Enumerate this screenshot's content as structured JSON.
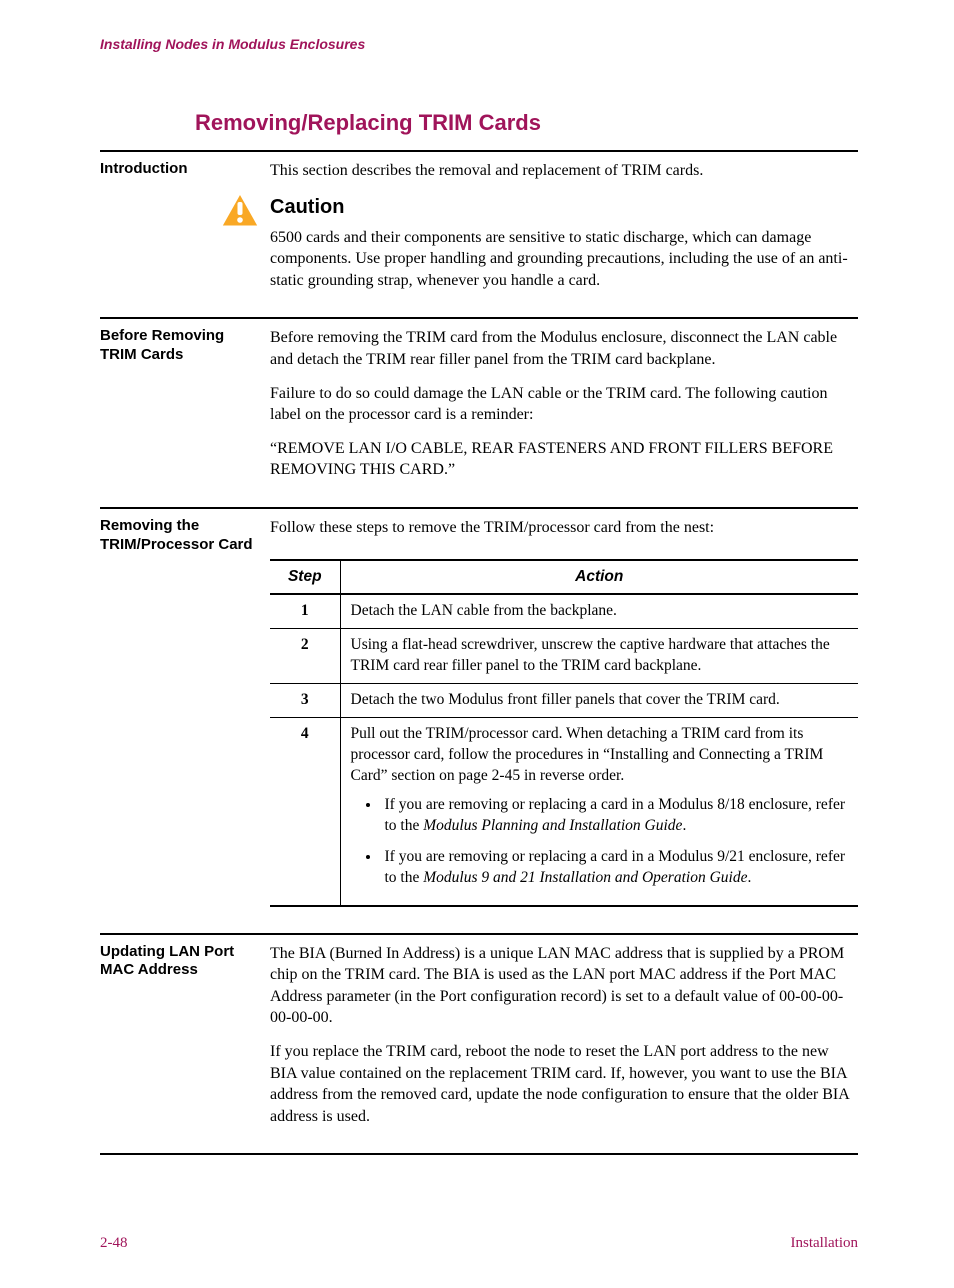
{
  "header": "Installing Nodes in Modulus Enclosures",
  "title": "Removing/Replacing TRIM Cards",
  "intro": {
    "label": "Introduction",
    "text": "This section describes the removal and replacement of TRIM cards.",
    "caution_heading": "Caution",
    "caution_text": "6500 cards and their components are sensitive to static discharge, which can damage components. Use proper handling and grounding precautions, including the use of an anti-static grounding strap, whenever you handle a card."
  },
  "before": {
    "label": "Before Removing TRIM Cards",
    "p1": "Before removing the TRIM card from the Modulus enclosure, disconnect the LAN cable and detach the TRIM rear filler panel from the TRIM card backplane.",
    "p2": "Failure to do so could damage the LAN cable or the TRIM card. The following caution label on the processor card is a reminder:",
    "p3": "“REMOVE LAN I/O CABLE, REAR FASTENERS AND FRONT FILLERS BEFORE REMOVING THIS CARD.”"
  },
  "removing": {
    "label": "Removing the TRIM/Processor Card",
    "intro": "Follow these steps to remove the TRIM/processor card from the nest:",
    "headers": {
      "step": "Step",
      "action": "Action"
    },
    "rows": [
      {
        "n": "1",
        "a": "Detach the LAN cable from the backplane."
      },
      {
        "n": "2",
        "a": "Using a flat-head screwdriver, unscrew the captive hardware that attaches the TRIM card rear filler panel to the TRIM card backplane."
      },
      {
        "n": "3",
        "a": "Detach the two Modulus front filler panels that cover the TRIM card."
      },
      {
        "n": "4",
        "a": "Pull out the TRIM/processor card. When detaching a TRIM card from its processor card, follow the procedures in “Installing and Connecting a TRIM Card” section on page 2-45 in reverse order.",
        "b1_pre": "If you are removing or replacing a card in a Modulus 8/18 enclosure, refer to the ",
        "b1_it": "Modulus Planning and Installation Guide",
        "b1_post": ".",
        "b2_pre": "If you are removing or replacing a card in a Modulus 9/21 enclosure, refer to the ",
        "b2_it": "Modulus 9 and 21 Installation and Operation Guide",
        "b2_post": "."
      }
    ]
  },
  "updating": {
    "label": "Updating LAN Port MAC Address",
    "p1": "The BIA (Burned In Address) is a unique LAN MAC address that is supplied by a PROM chip on the TRIM card. The BIA is used as the LAN port MAC address if the Port MAC Address parameter (in the Port configuration record) is set to a default value of 00-00-00-00-00-00.",
    "p2": "If you replace the TRIM card, reboot the node to reset the LAN port address to the new BIA value contained on the replacement TRIM card. If, however, you want to use the BIA address from the removed card, update the node configuration to ensure that the older BIA address is used."
  },
  "footer": {
    "left": "2-48",
    "right": "Installation"
  }
}
